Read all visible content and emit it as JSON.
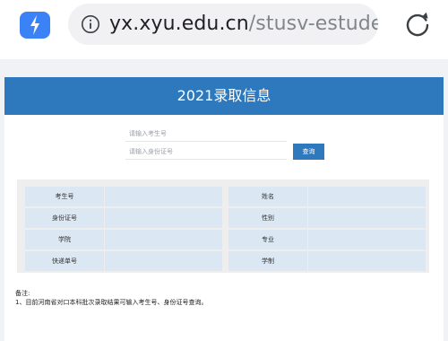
{
  "browser": {
    "url_host": "yx.xyu.edu.cn",
    "url_path": "/stusv-estudent-",
    "app_icon": "bolt-icon",
    "info_icon": "info-icon",
    "reload_icon": "reload-icon"
  },
  "page": {
    "title": "2021录取信息",
    "search": {
      "exam_placeholder": "请输入考生号",
      "id_placeholder": "请输入身份证号",
      "button_label": "查询"
    },
    "left_table": [
      {
        "label": "考生号",
        "value": ""
      },
      {
        "label": "身份证号",
        "value": ""
      },
      {
        "label": "学院",
        "value": ""
      },
      {
        "label": "快递单号",
        "value": ""
      }
    ],
    "right_table": [
      {
        "label": "姓名",
        "value": ""
      },
      {
        "label": "性别",
        "value": ""
      },
      {
        "label": "专业",
        "value": ""
      },
      {
        "label": "学制",
        "value": ""
      }
    ],
    "notes": {
      "heading": "备注:",
      "line1": "1、目前河南省对口本科批次录取结果可输入考生号、身份证号查询。"
    }
  },
  "colors": {
    "accent": "#2e79be",
    "app_icon": "#3b82f6",
    "cell_bg": "#dbe7f3"
  }
}
